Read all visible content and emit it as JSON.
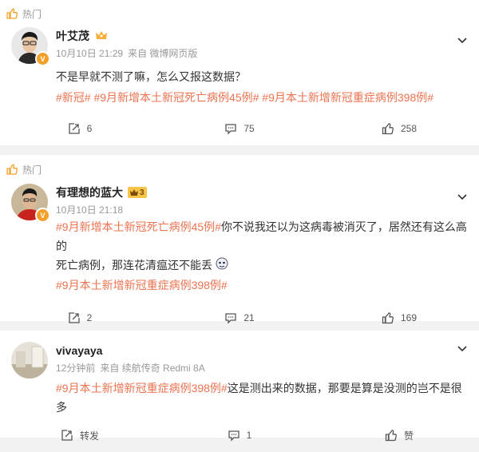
{
  "posts": [
    {
      "hot_label": "热门",
      "username": "叶艾茂",
      "time": "10月10日 21:29",
      "source": "来自 微博网页版",
      "body": "不是早就不测了嘛，怎么又报这数据？",
      "tags_line": [
        "#新冠#",
        "#9月新增本土新冠死亡病例45例#",
        "#9月本土新增新冠重症病例398例#"
      ],
      "repost": "6",
      "comment": "75",
      "like": "258"
    },
    {
      "hot_label": "热门",
      "username": "有理想的蓝大",
      "badge_level": "3",
      "time": "10月10日 21:18",
      "lead_tag": "#9月新增本土新冠死亡病例45例#",
      "body1": "你不说我还以为这病毒被消灭了，居然还有这么高的",
      "body2": "死亡病例，那连花清瘟还不能丢",
      "tag2": "#9月本土新增新冠重症病例398例#",
      "repost": "2",
      "comment": "21",
      "like": "169"
    },
    {
      "username": "vivayaya",
      "time": "12分钟前",
      "source": "来自 续航传奇 Redmi 8A",
      "lead_tag": "#9月本土新增新冠重症病例398例#",
      "body": "这是测出来的数据，那要是算是没测的岂不是很多",
      "repost": "转发",
      "comment": "1",
      "like": "赞"
    }
  ],
  "colors": {
    "tag": "#eb7350",
    "hot_icon": "#f3a02a",
    "meta": "#999999"
  }
}
